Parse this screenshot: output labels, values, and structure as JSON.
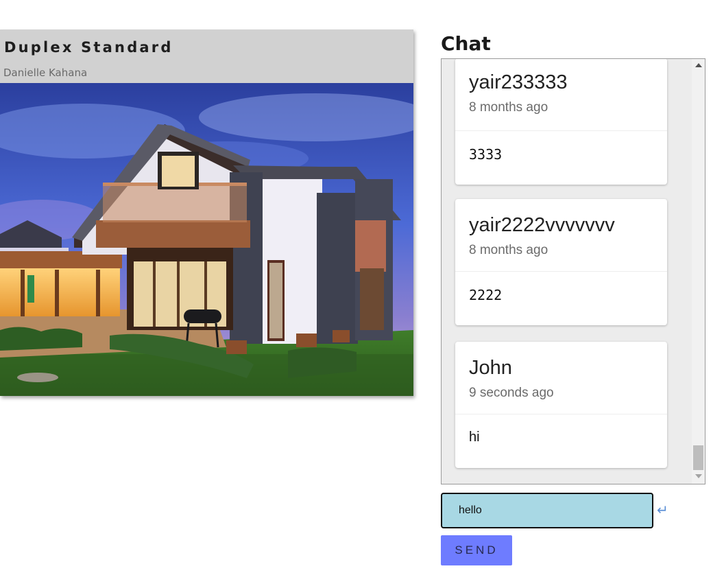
{
  "property": {
    "title": "Duplex Standard",
    "owner": "Danielle Kahana",
    "image_icon": "house-photo"
  },
  "chat": {
    "title": "Chat",
    "messages": [
      {
        "user": "yair233333",
        "time": "8 months ago",
        "text": "3333"
      },
      {
        "user": "yair2222vvvvvvv",
        "time": "8 months ago",
        "text": "2222"
      },
      {
        "user": "John",
        "time": "9 seconds ago",
        "text": "hi"
      }
    ],
    "input_value": "hello",
    "enter_icon": "enter-icon",
    "send_label": "SEND"
  },
  "colors": {
    "input_bg": "#a8d8e4",
    "send_bg": "#6e7cff",
    "card_header_bg": "#d1d1d1"
  }
}
